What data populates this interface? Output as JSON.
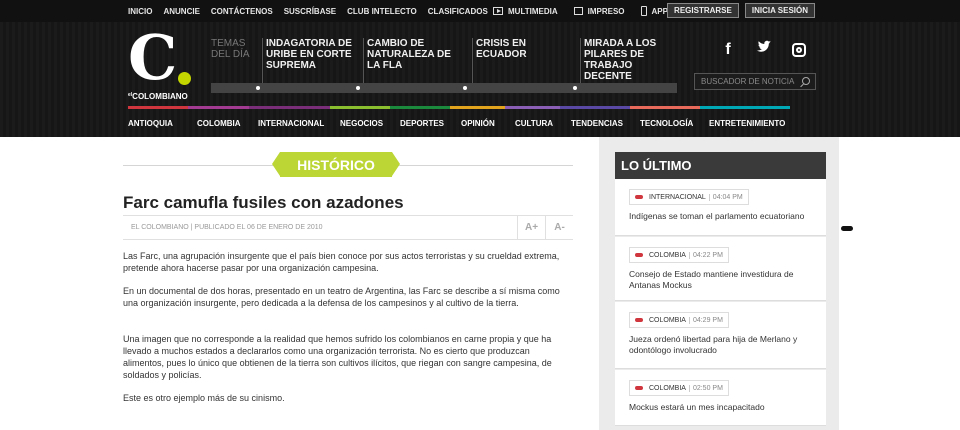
{
  "topnav": [
    "INICIO",
    "ANUNCIE",
    "CONTÁCTENOS",
    "SUSCRÍBASE",
    "CLUB INTELECTO",
    "CLASIFICADOS"
  ],
  "media": [
    {
      "label": "MULTIMEDIA",
      "icon": "play-icon"
    },
    {
      "label": "IMPRESO",
      "icon": "newspaper-icon"
    },
    {
      "label": "APPS",
      "icon": "phone-icon"
    }
  ],
  "account": {
    "register": "REGISTRARSE",
    "login": "INICIA SESIÓN"
  },
  "logo": {
    "letter": "C",
    "brand_prefix": "el",
    "brand": "COLOMBIANO"
  },
  "temas_label": "TEMAS DEL DÍA",
  "topics": [
    "INDAGATORIA DE URIBE EN CORTE SUPREMA",
    "CAMBIO DE NATURALEZA DE LA FLA",
    "CRISIS EN ECUADOR",
    "MIRADA A LOS PILARES DE TRABAJO DECENTE"
  ],
  "social": {
    "facebook": "f",
    "twitter": "twitter",
    "instagram": "instagram"
  },
  "search": {
    "placeholder": "BUSCADOR DE NOTICIAS"
  },
  "colors": {
    "accent": "#bcd635",
    "red": "#d0363e",
    "dark": "#1a1a1a"
  },
  "category_colors": [
    "#d0363e",
    "#a33b93",
    "#8bbf2f",
    "#2e9ee0",
    "#1b8a3d",
    "#e2a31d",
    "#8a5fb5",
    "#e76a5a",
    "#00a8b5"
  ],
  "mainnav": [
    "ANTIOQUIA",
    "COLOMBIA",
    "INTERNACIONAL",
    "NEGOCIOS",
    "DEPORTES",
    "OPINIÓN",
    "CULTURA",
    "TENDENCIAS",
    "TECNOLOGÍA",
    "ENTRETENIMIENTO"
  ],
  "section_label": "HISTÓRICO",
  "article": {
    "title": "Farc camufla fusiles con azadones",
    "meta": "EL COLOMBIANO | PUBLICADO EL 06 DE ENERO DE 2010",
    "font_up": "A+",
    "font_down": "A-",
    "paragraphs": [
      "Las Farc, una agrupación insurgente que el país bien conoce por sus actos terroristas y su crueldad extrema, pretende ahora hacerse pasar por una organización campesina.",
      "En un documental de dos horas, presentado en un teatro de Argentina, las Farc se describe a sí misma como una organización insurgente, pero dedicada a la defensa de los campesinos y al cultivo de la tierra.",
      "Una imagen que no corresponde a la realidad que hemos sufrido los colombianos en carne propia y que ha llevado a muchos estados a declararlos como una organización terrorista. No es cierto que produzcan alimentos, pues lo único que obtienen de la tierra son cultivos ilícitos, que riegan con sangre campesina, de soldados y policías.",
      "Este es otro ejemplo más de su cinismo."
    ]
  },
  "latest": {
    "title": "LO ÚLTIMO",
    "items": [
      {
        "category": "INTERNACIONAL",
        "time": "04:04 PM",
        "headline": "Indígenas se toman el parlamento ecuatoriano"
      },
      {
        "category": "COLOMBIA",
        "time": "04:22 PM",
        "headline": "Consejo de Estado mantiene investidura de Antanas Mockus"
      },
      {
        "category": "COLOMBIA",
        "time": "04:29 PM",
        "headline": "Jueza ordenó libertad para hija de Merlano y odontólogo involucrado"
      },
      {
        "category": "COLOMBIA",
        "time": "02:50 PM",
        "headline": "Mockus estará un mes incapacitado"
      }
    ]
  }
}
